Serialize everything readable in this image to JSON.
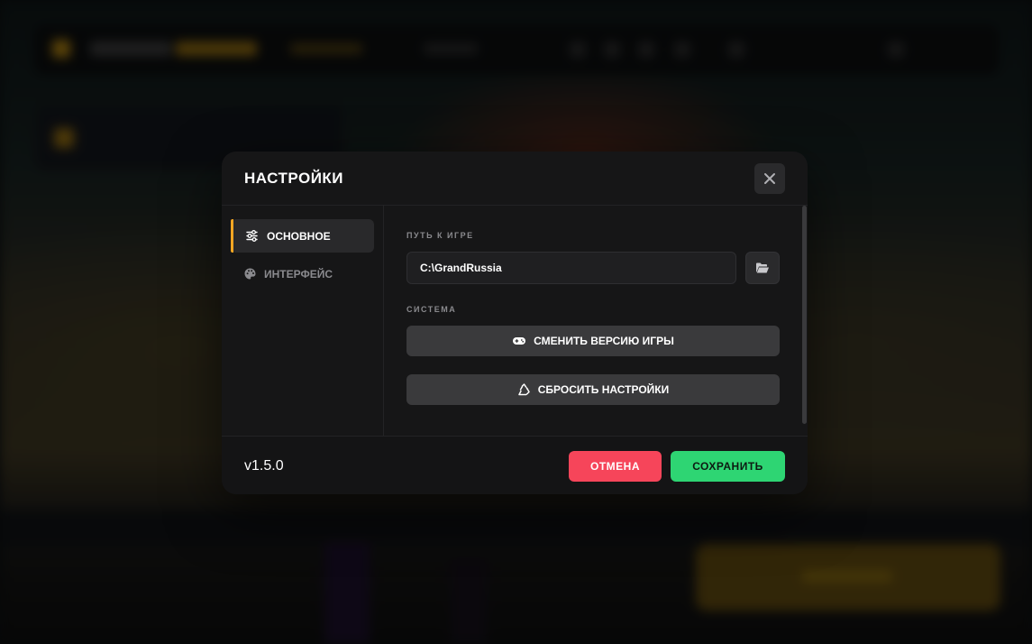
{
  "modal": {
    "title": "НАСТРОЙКИ",
    "close_icon": "close-icon"
  },
  "sidebar": {
    "items": [
      {
        "label": "ОСНОВНОЕ",
        "icon": "sliders-icon",
        "active": true
      },
      {
        "label": "ИНТЕРФЕЙС",
        "icon": "palette-icon",
        "active": false
      }
    ]
  },
  "content": {
    "game_path": {
      "label": "ПУТЬ К ИГРЕ",
      "value": "C:\\GrandRussia",
      "browse_icon": "folder-open-icon"
    },
    "system": {
      "label": "СИСТЕМА",
      "change_version_label": "СМЕНИТЬ ВЕРСИЮ ИГРЫ",
      "change_version_icon": "gamepad-icon",
      "reset_label": "СБРОСИТЬ НАСТРОЙКИ",
      "reset_icon": "recycle-icon"
    }
  },
  "footer": {
    "version": "v1.5.0",
    "cancel_label": "ОТМЕНА",
    "save_label": "СОХРАНИТЬ"
  },
  "colors": {
    "accent": "#f5a623",
    "cancel": "#f6455a",
    "save": "#2ed573",
    "modal_bg": "#161617"
  }
}
